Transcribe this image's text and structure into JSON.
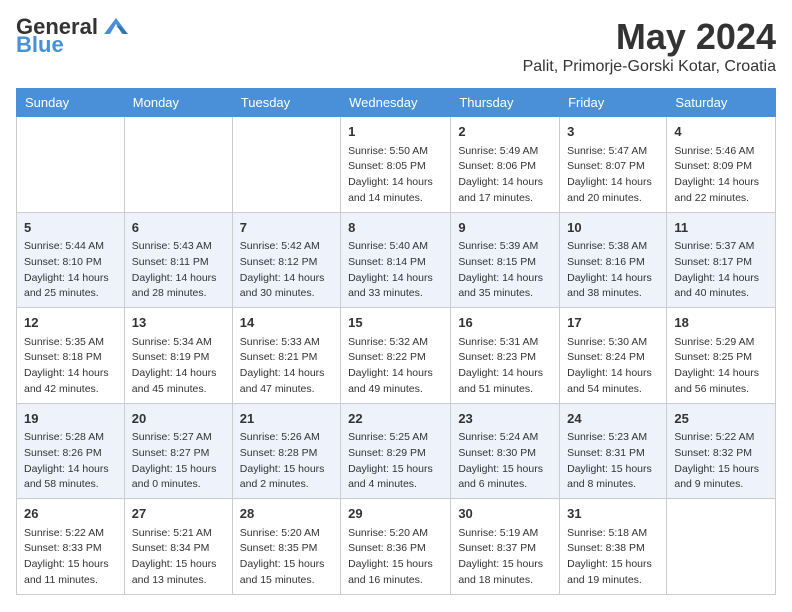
{
  "header": {
    "logo_general": "General",
    "logo_blue": "Blue",
    "month_year": "May 2024",
    "location": "Palit, Primorje-Gorski Kotar, Croatia"
  },
  "weekdays": [
    "Sunday",
    "Monday",
    "Tuesday",
    "Wednesday",
    "Thursday",
    "Friday",
    "Saturday"
  ],
  "weeks": [
    [
      {
        "day": "",
        "info": ""
      },
      {
        "day": "",
        "info": ""
      },
      {
        "day": "",
        "info": ""
      },
      {
        "day": "1",
        "info": "Sunrise: 5:50 AM\nSunset: 8:05 PM\nDaylight: 14 hours and 14 minutes."
      },
      {
        "day": "2",
        "info": "Sunrise: 5:49 AM\nSunset: 8:06 PM\nDaylight: 14 hours and 17 minutes."
      },
      {
        "day": "3",
        "info": "Sunrise: 5:47 AM\nSunset: 8:07 PM\nDaylight: 14 hours and 20 minutes."
      },
      {
        "day": "4",
        "info": "Sunrise: 5:46 AM\nSunset: 8:09 PM\nDaylight: 14 hours and 22 minutes."
      }
    ],
    [
      {
        "day": "5",
        "info": "Sunrise: 5:44 AM\nSunset: 8:10 PM\nDaylight: 14 hours and 25 minutes."
      },
      {
        "day": "6",
        "info": "Sunrise: 5:43 AM\nSunset: 8:11 PM\nDaylight: 14 hours and 28 minutes."
      },
      {
        "day": "7",
        "info": "Sunrise: 5:42 AM\nSunset: 8:12 PM\nDaylight: 14 hours and 30 minutes."
      },
      {
        "day": "8",
        "info": "Sunrise: 5:40 AM\nSunset: 8:14 PM\nDaylight: 14 hours and 33 minutes."
      },
      {
        "day": "9",
        "info": "Sunrise: 5:39 AM\nSunset: 8:15 PM\nDaylight: 14 hours and 35 minutes."
      },
      {
        "day": "10",
        "info": "Sunrise: 5:38 AM\nSunset: 8:16 PM\nDaylight: 14 hours and 38 minutes."
      },
      {
        "day": "11",
        "info": "Sunrise: 5:37 AM\nSunset: 8:17 PM\nDaylight: 14 hours and 40 minutes."
      }
    ],
    [
      {
        "day": "12",
        "info": "Sunrise: 5:35 AM\nSunset: 8:18 PM\nDaylight: 14 hours and 42 minutes."
      },
      {
        "day": "13",
        "info": "Sunrise: 5:34 AM\nSunset: 8:19 PM\nDaylight: 14 hours and 45 minutes."
      },
      {
        "day": "14",
        "info": "Sunrise: 5:33 AM\nSunset: 8:21 PM\nDaylight: 14 hours and 47 minutes."
      },
      {
        "day": "15",
        "info": "Sunrise: 5:32 AM\nSunset: 8:22 PM\nDaylight: 14 hours and 49 minutes."
      },
      {
        "day": "16",
        "info": "Sunrise: 5:31 AM\nSunset: 8:23 PM\nDaylight: 14 hours and 51 minutes."
      },
      {
        "day": "17",
        "info": "Sunrise: 5:30 AM\nSunset: 8:24 PM\nDaylight: 14 hours and 54 minutes."
      },
      {
        "day": "18",
        "info": "Sunrise: 5:29 AM\nSunset: 8:25 PM\nDaylight: 14 hours and 56 minutes."
      }
    ],
    [
      {
        "day": "19",
        "info": "Sunrise: 5:28 AM\nSunset: 8:26 PM\nDaylight: 14 hours and 58 minutes."
      },
      {
        "day": "20",
        "info": "Sunrise: 5:27 AM\nSunset: 8:27 PM\nDaylight: 15 hours and 0 minutes."
      },
      {
        "day": "21",
        "info": "Sunrise: 5:26 AM\nSunset: 8:28 PM\nDaylight: 15 hours and 2 minutes."
      },
      {
        "day": "22",
        "info": "Sunrise: 5:25 AM\nSunset: 8:29 PM\nDaylight: 15 hours and 4 minutes."
      },
      {
        "day": "23",
        "info": "Sunrise: 5:24 AM\nSunset: 8:30 PM\nDaylight: 15 hours and 6 minutes."
      },
      {
        "day": "24",
        "info": "Sunrise: 5:23 AM\nSunset: 8:31 PM\nDaylight: 15 hours and 8 minutes."
      },
      {
        "day": "25",
        "info": "Sunrise: 5:22 AM\nSunset: 8:32 PM\nDaylight: 15 hours and 9 minutes."
      }
    ],
    [
      {
        "day": "26",
        "info": "Sunrise: 5:22 AM\nSunset: 8:33 PM\nDaylight: 15 hours and 11 minutes."
      },
      {
        "day": "27",
        "info": "Sunrise: 5:21 AM\nSunset: 8:34 PM\nDaylight: 15 hours and 13 minutes."
      },
      {
        "day": "28",
        "info": "Sunrise: 5:20 AM\nSunset: 8:35 PM\nDaylight: 15 hours and 15 minutes."
      },
      {
        "day": "29",
        "info": "Sunrise: 5:20 AM\nSunset: 8:36 PM\nDaylight: 15 hours and 16 minutes."
      },
      {
        "day": "30",
        "info": "Sunrise: 5:19 AM\nSunset: 8:37 PM\nDaylight: 15 hours and 18 minutes."
      },
      {
        "day": "31",
        "info": "Sunrise: 5:18 AM\nSunset: 8:38 PM\nDaylight: 15 hours and 19 minutes."
      },
      {
        "day": "",
        "info": ""
      }
    ]
  ]
}
